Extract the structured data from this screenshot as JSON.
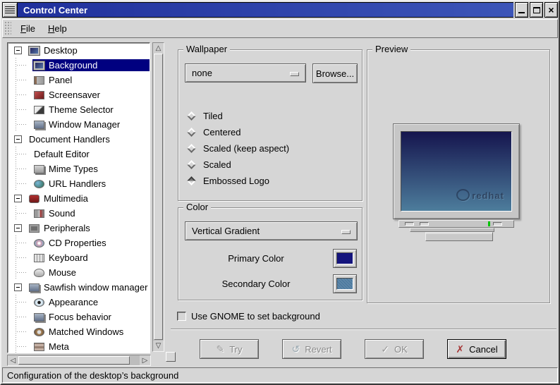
{
  "window": {
    "title": "Control Center",
    "controls": {
      "minimize": "minimize",
      "maximize": "maximize",
      "close": "close"
    }
  },
  "menubar": {
    "items": [
      {
        "label": "File",
        "underline": "F"
      },
      {
        "label": "Help",
        "underline": "H"
      }
    ]
  },
  "tree": {
    "items": [
      {
        "label": "Desktop",
        "level": 0,
        "expanded": true,
        "icon": "desktop",
        "selected": false
      },
      {
        "label": "Background",
        "level": 1,
        "icon": "background",
        "selected": true
      },
      {
        "label": "Panel",
        "level": 1,
        "icon": "panel",
        "selected": false
      },
      {
        "label": "Screensaver",
        "level": 1,
        "icon": "screensaver",
        "selected": false
      },
      {
        "label": "Theme Selector",
        "level": 1,
        "icon": "theme-selector",
        "selected": false
      },
      {
        "label": "Window Manager",
        "level": 1,
        "icon": "window-manager",
        "selected": false
      },
      {
        "label": "Document Handlers",
        "level": 0,
        "expanded": true,
        "icon": null,
        "selected": false
      },
      {
        "label": "Default Editor",
        "level": 1,
        "icon": null,
        "selected": false
      },
      {
        "label": "Mime Types",
        "level": 1,
        "icon": "mime-types",
        "selected": false
      },
      {
        "label": "URL Handlers",
        "level": 1,
        "icon": "url-handlers",
        "selected": false
      },
      {
        "label": "Multimedia",
        "level": 0,
        "expanded": true,
        "icon": "multimedia",
        "selected": false
      },
      {
        "label": "Sound",
        "level": 1,
        "icon": "sound",
        "selected": false
      },
      {
        "label": "Peripherals",
        "level": 0,
        "expanded": true,
        "icon": "peripherals",
        "selected": false
      },
      {
        "label": "CD Properties",
        "level": 1,
        "icon": "cd-properties",
        "selected": false
      },
      {
        "label": "Keyboard",
        "level": 1,
        "icon": "keyboard",
        "selected": false
      },
      {
        "label": "Mouse",
        "level": 1,
        "icon": "mouse",
        "selected": false
      },
      {
        "label": "Sawfish window manager",
        "level": 0,
        "expanded": true,
        "icon": "sawfish",
        "selected": false
      },
      {
        "label": "Appearance",
        "level": 1,
        "icon": "appearance",
        "selected": false
      },
      {
        "label": "Focus behavior",
        "level": 1,
        "icon": "focus-behavior",
        "selected": false
      },
      {
        "label": "Matched Windows",
        "level": 1,
        "icon": "matched-windows",
        "selected": false
      },
      {
        "label": "Meta",
        "level": 1,
        "icon": "meta",
        "selected": false
      }
    ]
  },
  "wallpaper": {
    "legend": "Wallpaper",
    "file_select_value": "none",
    "browse_label": "Browse...",
    "modes": [
      {
        "label": "Tiled",
        "selected": false
      },
      {
        "label": "Centered",
        "selected": false
      },
      {
        "label": "Scaled (keep aspect)",
        "selected": false
      },
      {
        "label": "Scaled",
        "selected": false
      },
      {
        "label": "Embossed Logo",
        "selected": true
      }
    ]
  },
  "color": {
    "legend": "Color",
    "gradient_select_value": "Vertical Gradient",
    "primary": {
      "label": "Primary Color",
      "color": "#14147d"
    },
    "secondary": {
      "label": "Secondary Color",
      "color": "#4e7ba0"
    }
  },
  "preview": {
    "legend": "Preview",
    "logo_text": "redhat",
    "screen_top": "#15154e",
    "screen_bottom": "#4d7d9c",
    "led_color": "#00c400"
  },
  "gnome_checkbox": {
    "label": "Use GNOME to set background",
    "checked": false
  },
  "actions": [
    {
      "label": "Try",
      "enabled": false,
      "icon": "try"
    },
    {
      "label": "Revert",
      "enabled": false,
      "icon": "revert"
    },
    {
      "label": "OK",
      "enabled": false,
      "icon": "ok"
    },
    {
      "label": "Cancel",
      "enabled": true,
      "icon": "cancel"
    }
  ],
  "statusbar": {
    "text": "Configuration of the desktop’s background"
  },
  "colors": {
    "selection": "#000080",
    "titlebar_left": "#20309c",
    "titlebar_right": "#3c55b8"
  }
}
